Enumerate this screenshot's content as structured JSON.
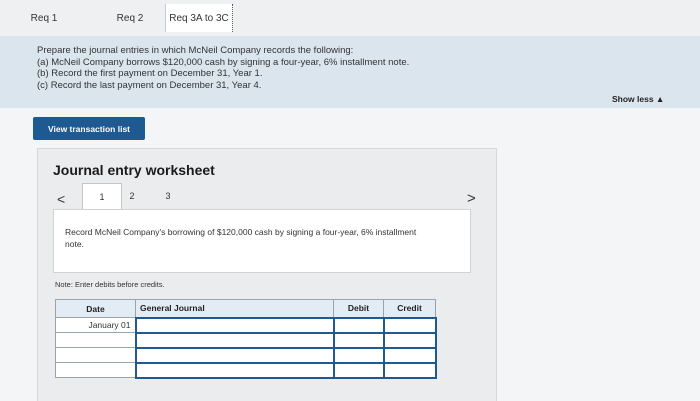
{
  "tabs": [
    {
      "label": "Req 1"
    },
    {
      "label": "Req 2"
    },
    {
      "label": "Req 3A to 3C"
    }
  ],
  "requirements": {
    "intro": "Prepare the journal entries in which McNeil Company records the following:",
    "items": [
      "(a) McNeil Company borrows $120,000 cash by signing a four-year, 6% installment note.",
      "(b) Record the first payment on December 31, Year 1.",
      "(c) Record the last payment on December 31, Year 4."
    ]
  },
  "show_less": {
    "label": "Show less ▲"
  },
  "view_button": {
    "label": "View transaction list"
  },
  "worksheet": {
    "title": "Journal entry worksheet",
    "prev_icon": "<",
    "next_icon": ">",
    "steps": [
      "1",
      "2",
      "3"
    ],
    "active_step": "1",
    "description": "Record McNeil Company's borrowing of $120,000 cash by signing a four-year, 6% installment note.",
    "note": "Note: Enter debits before credits.",
    "table": {
      "headers": {
        "date": "Date",
        "general_journal": "General Journal",
        "debit": "Debit",
        "credit": "Credit"
      },
      "rows": [
        {
          "date": "January 01",
          "account": "",
          "debit": "",
          "credit": ""
        },
        {
          "date": "",
          "account": "",
          "debit": "",
          "credit": ""
        },
        {
          "date": "",
          "account": "",
          "debit": "",
          "credit": ""
        },
        {
          "date": "",
          "account": "",
          "debit": "",
          "credit": ""
        }
      ]
    }
  },
  "colors": {
    "accent": "#1e5a91",
    "panel": "#dbe5ee",
    "table_header": "#e3ecf4"
  }
}
